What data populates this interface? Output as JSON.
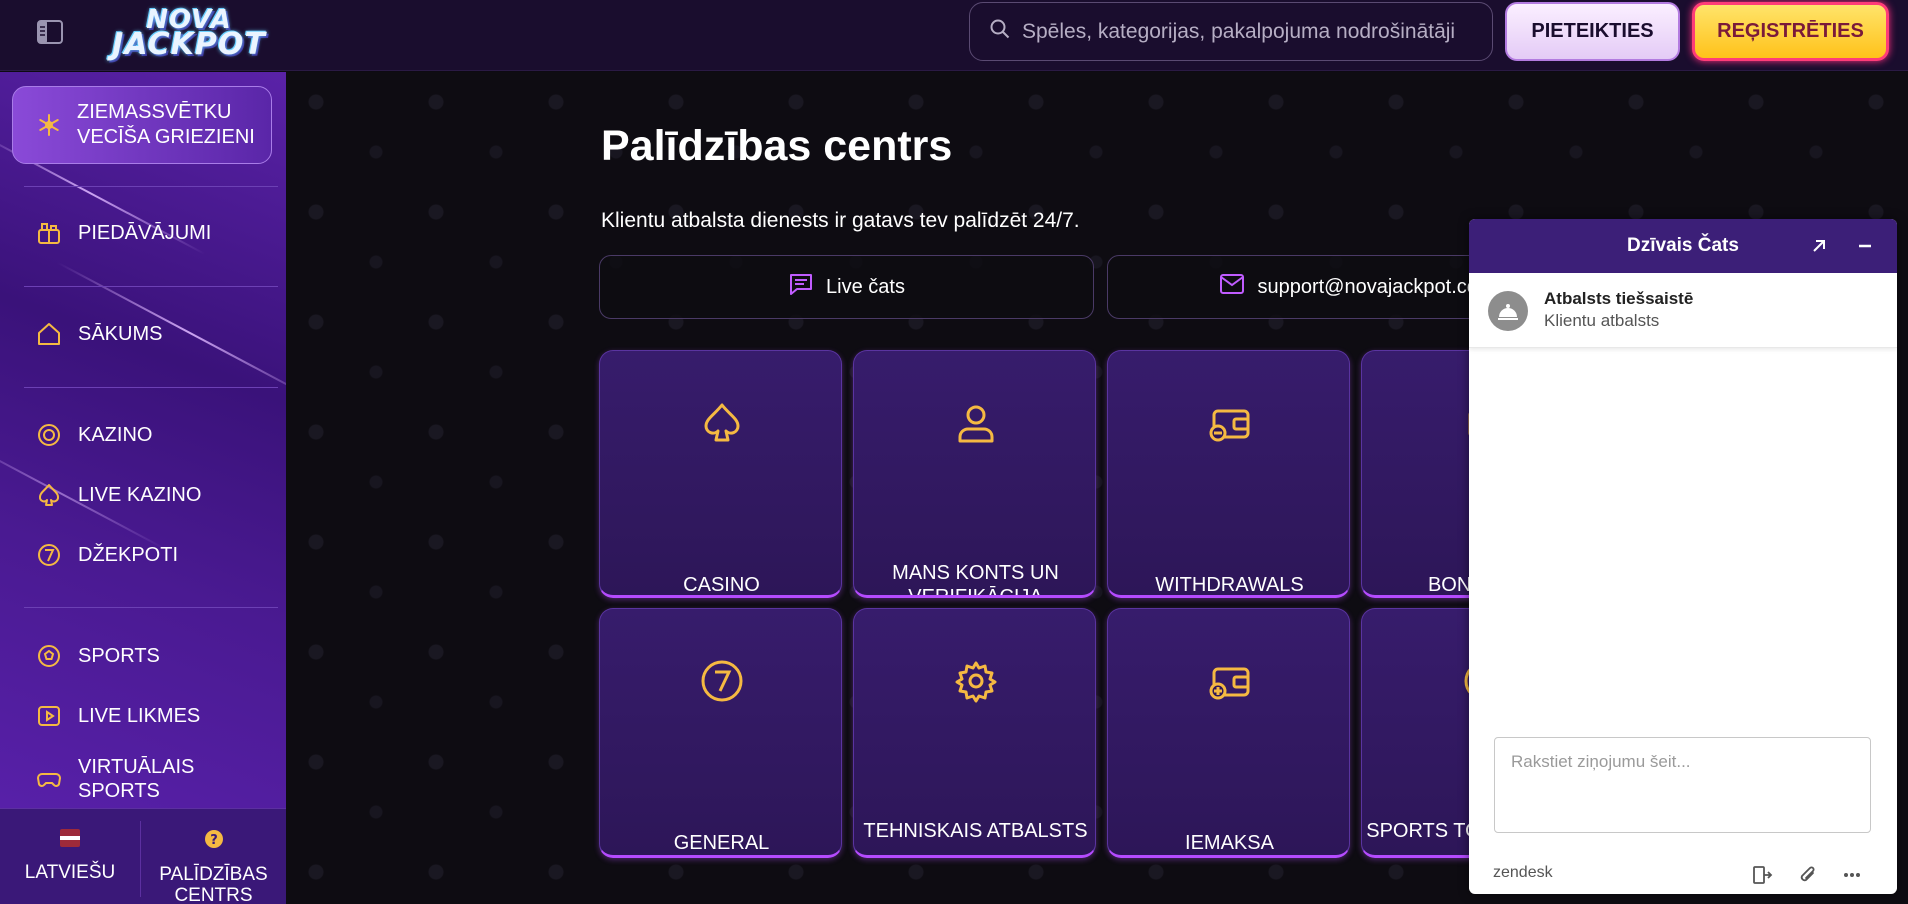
{
  "header": {
    "logo_line1": "NOVA",
    "logo_line2": "JACKPOT",
    "search_placeholder": "Spēles, kategorijas, pakalpojuma nodrošinātāji",
    "login_label": "PIETEIKTIES",
    "register_label": "REĢISTRĒTIES"
  },
  "sidebar": {
    "promo_label": "ZIEMASSVĒTKU VECĪŠA GRIEZIENI",
    "items": [
      {
        "label": "PIEDĀVĀJUMI",
        "icon": "gift-icon"
      },
      {
        "label": "SĀKUMS",
        "icon": "home-icon"
      },
      {
        "label": "KAZINO",
        "icon": "casino-chip-icon"
      },
      {
        "label": "LIVE KAZINO",
        "icon": "spade-icon"
      },
      {
        "label": "DŽEKPOTI",
        "icon": "seven-icon"
      },
      {
        "label": "SPORTS",
        "icon": "soccer-ball-icon"
      },
      {
        "label": "LIVE LIKMES",
        "icon": "play-icon"
      },
      {
        "label": "VIRTUĀLAIS SPORTS",
        "icon": "gamepad-icon"
      }
    ],
    "footer": {
      "language_label": "LATVIEŠU",
      "help_label": "PALĪDZĪBAS CENTRS"
    }
  },
  "main": {
    "title": "Palīdzības centrs",
    "subtitle": "Klientu atbalsta dienests ir gatavs tev palīdzēt 24/7.",
    "live_chat_label": "Live čats",
    "email_label": "support@novajackpot.com",
    "categories": [
      {
        "label": "CASINO",
        "icon": "spade-icon"
      },
      {
        "label": "MANS KONTS UN VERIFIKĀCIJA",
        "icon": "user-icon"
      },
      {
        "label": "WITHDRAWALS",
        "icon": "wallet-minus-icon"
      },
      {
        "label": "BONUSI UN",
        "icon": "bonus-icon"
      },
      {
        "label": "GENERAL",
        "icon": "seven-icon"
      },
      {
        "label": "TEHNISKAIS ATBALSTS",
        "icon": "gear-icon"
      },
      {
        "label": "IEMAKSA",
        "icon": "wallet-plus-icon"
      },
      {
        "label": "SPORTS TOTALIZATORS",
        "icon": "ball-icon"
      }
    ]
  },
  "chat": {
    "title": "Dzīvais Čats",
    "agent_name": "Atbalsts tiešsaistē",
    "agent_role": "Klientu atbalsts",
    "input_placeholder": "Rakstiet ziņojumu šeit...",
    "brand": "zendesk"
  },
  "colors": {
    "accent_gold": "#f5b942",
    "card_border": "#b54bff",
    "chat_header": "#3c1f78"
  }
}
